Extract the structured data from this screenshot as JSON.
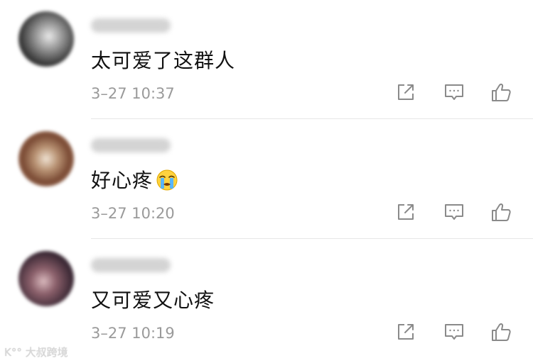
{
  "comments": [
    {
      "username": "",
      "text": "太可爱了这群人",
      "emoji": "",
      "time": "3–27 10:37"
    },
    {
      "username": "",
      "text": "好心疼",
      "emoji": "crying-face",
      "time": "3–27 10:20"
    },
    {
      "username": "",
      "text": "又可爱又心疼",
      "emoji": "",
      "time": "3–27 10:19"
    }
  ],
  "actions": {
    "share_icon": "share-icon",
    "reply_icon": "comment-icon",
    "like_icon": "thumbs-up-icon"
  },
  "watermark": "K°° 大叔跨境",
  "colors": {
    "text": "#111111",
    "timestamp": "#9a9a9a",
    "icon": "#8a8a8a",
    "divider": "#e6e6e6"
  }
}
